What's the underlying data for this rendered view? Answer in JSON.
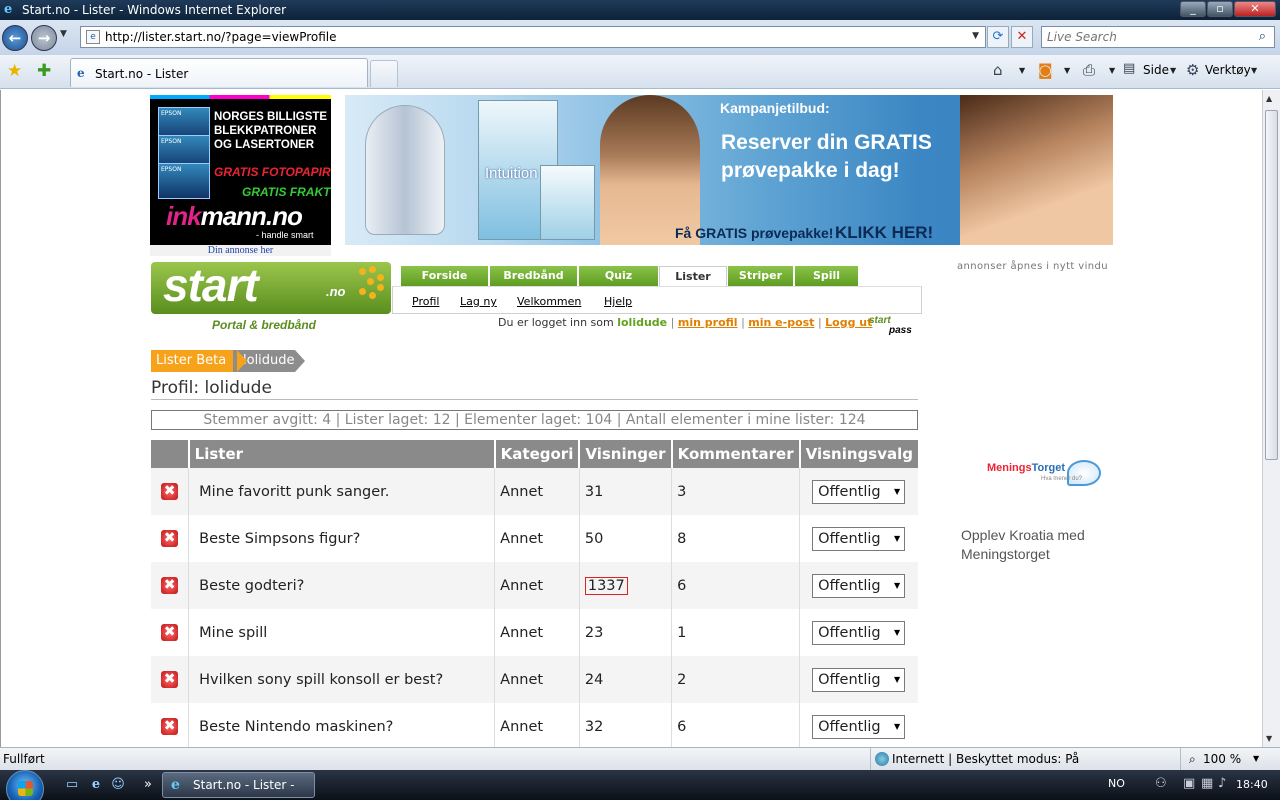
{
  "window": {
    "title": "Start.no - Lister - Windows Internet Explorer"
  },
  "address": {
    "url": "http://lister.start.no/?page=viewProfile",
    "search_placeholder": "Live Search"
  },
  "tab": {
    "title": "Start.no - Lister"
  },
  "commands": {
    "page_label": "Side",
    "tools_label": "Verktøy"
  },
  "ads": {
    "left": {
      "headline": "NORGES BILLIGSTE BLEKKPATRONER OG LASERTONER",
      "red_text": "GRATIS FOTOPAPIR",
      "green_text": "GRATIS FRAKT",
      "logo_ink": "ink",
      "logo_rest": "mann.no",
      "tagline": "- handle smart",
      "note": "Din annonse her"
    },
    "banner": {
      "kicker": "Kampanjetilbud:",
      "headline1": "Reserver din GRATIS",
      "headline2": "prøvepakke i dag!",
      "cta1": "Få GRATIS prøvepakke!",
      "cta2": "KLIKK HER!",
      "product": "Intuition"
    },
    "side_note": "annonser åpnes i nytt vindu",
    "right": {
      "brand_part1": "Menings",
      "brand_part2": "Torget",
      "brand_sub": "Hva mener du?",
      "text": "Opplev Kroatia med Meningstorget"
    }
  },
  "site": {
    "logo_word": "start",
    "logo_suffix": ".no",
    "tagline": "Portal & bredbånd",
    "nav_tabs": [
      "Forside",
      "Bredbånd",
      "Quiz",
      "Lister",
      "Striper",
      "Spill"
    ],
    "active_tab": "Lister",
    "subnav": [
      "Profil",
      "Lag ny",
      "Velkommen",
      "Hjelp"
    ],
    "login_prefix": "Du er logget inn som",
    "username": "lolidude",
    "link_profile": "min profil",
    "link_email": "min e-post",
    "link_logout": "Logg ut",
    "separator": "|",
    "startpass_top": "start",
    "startpass_bottom": "pass"
  },
  "breadcrumb": {
    "root": "Lister Beta",
    "current": "lolidude"
  },
  "profile": {
    "title": "Profil: lolidude",
    "stats": "Stemmer avgitt: 4 | Lister laget: 12 | Elementer laget: 104 | Antall elementer i mine lister: 124"
  },
  "table": {
    "headers": [
      "Lister",
      "Kategori",
      "Visninger",
      "Kommentarer",
      "Visningsvalg"
    ],
    "delete_glyph": "✖",
    "rows": [
      {
        "name": "Mine favoritt punk sanger.",
        "category": "Annet",
        "views": "31",
        "comments": "3",
        "visibility": "Offentlig"
      },
      {
        "name": "Beste Simpsons figur?",
        "category": "Annet",
        "views": "50",
        "comments": "8",
        "visibility": "Offentlig"
      },
      {
        "name": "Beste godteri?",
        "category": "Annet",
        "views": "1337",
        "comments": "6",
        "visibility": "Offentlig"
      },
      {
        "name": "Mine spill",
        "category": "Annet",
        "views": "23",
        "comments": "1",
        "visibility": "Offentlig"
      },
      {
        "name": "Hvilken sony spill konsoll er best?",
        "category": "Annet",
        "views": "24",
        "comments": "2",
        "visibility": "Offentlig"
      },
      {
        "name": "Beste Nintendo maskinen?",
        "category": "Annet",
        "views": "32",
        "comments": "6",
        "visibility": "Offentlig"
      }
    ]
  },
  "status": {
    "text": "Fullført",
    "zone": "Internett | Beskyttet modus: På",
    "zoom": "100 %"
  },
  "taskbar": {
    "window_button": "Start.no - Lister - Wi...",
    "language": "NO",
    "time": "18:40"
  }
}
